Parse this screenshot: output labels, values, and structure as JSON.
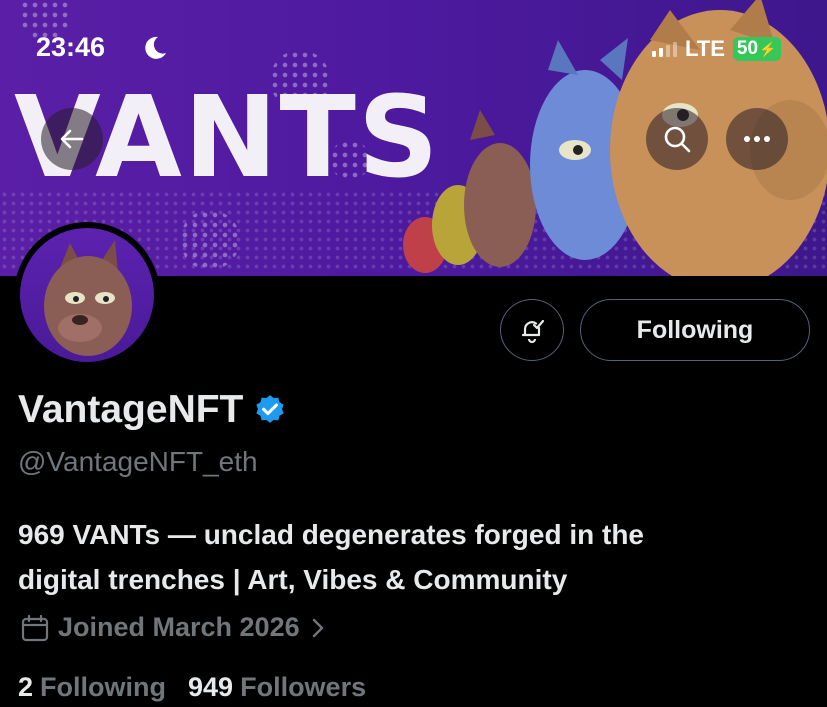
{
  "status_bar": {
    "time": "23:46",
    "network": "LTE",
    "battery": "50"
  },
  "banner": {
    "text": "VANTS"
  },
  "actions": {
    "following_label": "Following"
  },
  "profile": {
    "display_name": "VantageNFT",
    "handle": "@VantageNFT_eth",
    "bio_line1": "969 VANTs — unclad degenerates forged in the",
    "bio_line2": "digital trenches | Art, Vibes & Community",
    "joined": "Joined March 2026"
  },
  "stats": {
    "following_count": "2",
    "following_label": "Following",
    "followers_count": "949",
    "followers_label": "Followers"
  },
  "colors": {
    "accent": "#1d9bf0",
    "banner_purple": "#5a1fa6",
    "muted": "#71767b"
  },
  "icons": [
    "moon-icon",
    "signal-icon",
    "back-arrow-icon",
    "search-icon",
    "more-icon",
    "notification-bell-icon",
    "verified-badge-icon",
    "calendar-icon",
    "chevron-right-icon"
  ]
}
